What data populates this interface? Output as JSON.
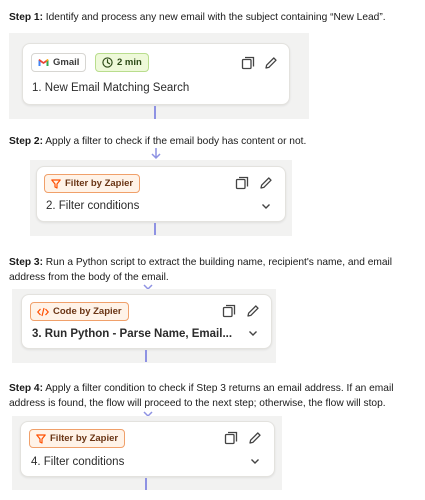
{
  "steps": [
    {
      "label": "Step 1:",
      "desc": " Identify and process any new email with the subject containing “New Lead”.",
      "app_badge": "Gmail",
      "time_badge": "2 min",
      "title": "1. New Email Matching Search"
    },
    {
      "label": "Step 2:",
      "desc": " Apply a filter to check if the email body has content or not.",
      "app_badge": "Filter by Zapier",
      "title": "2. Filter conditions"
    },
    {
      "label": "Step 3:",
      "desc": " Run a Python script to extract the building name, recipient's name, and email address from the body of the email.",
      "app_badge": "Code by Zapier",
      "title": "3. Run Python - Parse Name, Email..."
    },
    {
      "label": "Step 4:",
      "desc": " Apply a filter condition to check if Step 3 returns an email address. If an email address is found, the flow will proceed to the next step; otherwise, the flow will stop.",
      "app_badge": "Filter by Zapier",
      "title": "4. Filter conditions"
    }
  ],
  "colors": {
    "connector": "#8e92e3",
    "zapier_orange": "#ff4f00",
    "time_green": "#4a7a1f"
  },
  "icons": [
    "gmail-icon",
    "clock-icon",
    "copy-icon",
    "edit-icon",
    "filter-icon",
    "code-icon",
    "chevron-down-icon",
    "arrow-down-icon"
  ]
}
